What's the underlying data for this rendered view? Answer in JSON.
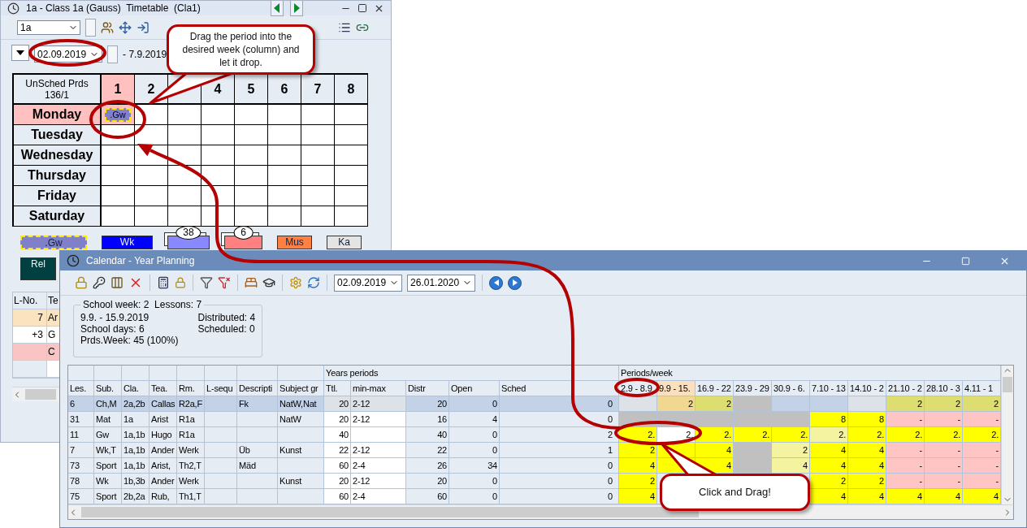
{
  "timetable_window": {
    "title": "1a - Class 1a (Gauss)  Timetable  (Cla1)",
    "class_select": "1a",
    "date": "02.09.2019",
    "date_range_end": "- 7.9.2019",
    "unscheduled": {
      "label": "UnSched Prds",
      "count": "136/1"
    },
    "periods": [
      {
        "label": "1",
        "selected": true
      },
      {
        "label": "2",
        "selected": false
      },
      {
        "selected": false
      },
      {
        "label": "4",
        "selected": false
      },
      {
        "label": "5",
        "selected": false
      },
      {
        "label": "6",
        "selected": false
      },
      {
        "label": "7",
        "selected": false
      },
      {
        "label": "8",
        "selected": false
      }
    ],
    "days": [
      {
        "label": "Monday",
        "selected": true,
        "slots": [
          {
            "selected": true,
            "lesson": ".Gw"
          },
          {
            "selected": false
          },
          {
            "selected": false
          },
          {
            "selected": false
          },
          {
            "selected": false
          },
          {
            "selected": false
          },
          {
            "selected": false
          },
          {
            "selected": false
          }
        ]
      },
      {
        "label": "Tuesday",
        "selected": false,
        "slots": [
          {
            "selected": false
          },
          {
            "selected": false
          },
          {
            "selected": false
          },
          {
            "selected": false
          },
          {
            "selected": false
          },
          {
            "selected": false
          },
          {
            "selected": false
          },
          {
            "selected": false
          }
        ]
      },
      {
        "label": "Wednesday",
        "selected": false,
        "slots": [
          {
            "selected": false
          },
          {
            "selected": false
          },
          {
            "selected": false
          },
          {
            "selected": false
          },
          {
            "selected": false
          },
          {
            "selected": false
          },
          {
            "selected": false
          },
          {
            "selected": false
          }
        ]
      },
      {
        "label": "Thursday",
        "selected": false,
        "slots": [
          {
            "selected": false
          },
          {
            "selected": false
          },
          {
            "selected": false
          },
          {
            "selected": false
          },
          {
            "selected": false
          },
          {
            "selected": false
          },
          {
            "selected": false
          },
          {
            "selected": false
          }
        ]
      },
      {
        "label": "Friday",
        "selected": false,
        "slots": [
          {
            "selected": false
          },
          {
            "selected": false
          },
          {
            "selected": false
          },
          {
            "selected": false
          },
          {
            "selected": false
          },
          {
            "selected": false
          },
          {
            "selected": false
          },
          {
            "selected": false
          }
        ]
      },
      {
        "label": "Saturday",
        "selected": false,
        "slots": [
          {
            "selected": false
          },
          {
            "selected": false
          },
          {
            "selected": false
          },
          {
            "selected": false
          },
          {
            "selected": false
          },
          {
            "selected": false
          },
          {
            "selected": false
          },
          {
            "selected": false
          }
        ]
      }
    ],
    "lesson_cards": [
      {
        "label": ".Gw",
        "color": "#8080c8",
        "selected": true
      },
      {
        "label": "Wk",
        "color": "#0000ff",
        "selected": false
      },
      {
        "badge": "38",
        "color": "#8888ff",
        "selected": false
      },
      {
        "badge": "6",
        "color": "#ff8080",
        "selected": false
      },
      {
        "label": "Mus",
        "color": "#ff8040",
        "selected": false
      },
      {
        "label": "Ka",
        "color": "#e4e4e4",
        "selected": false
      },
      {
        "label": "Rel",
        "color": "#004040",
        "selected": false
      }
    ],
    "lesson_list": {
      "columns": [
        "L-No.",
        "Te"
      ],
      "rows": [
        {
          "number": "7",
          "teacher": "Ar",
          "color": "#fbe3c0"
        },
        {
          "number": "+3",
          "teacher": "G",
          "color": "#ffffff"
        },
        {
          "teacher": "C",
          "color": "#f8c4c4"
        }
      ]
    }
  },
  "calendar_window": {
    "title": "Calendar - Year Planning",
    "date_from": "02.09.2019",
    "date_to": "26.01.2020",
    "info": {
      "legend": "School week: 2  Lessons: 7",
      "lines": [
        "9.9. - 15.9.2019",
        "School days: 6",
        "Prds.Week: 45 (100%)"
      ],
      "stats": [
        "Distributed: 4",
        "Scheduled: 0"
      ]
    },
    "table": {
      "years_group": "Years periods",
      "weeks_group": "Periods/week",
      "columns": [
        "Les.",
        "Sub.",
        "Cla.",
        "Tea.",
        "Rm.",
        "L-sequ",
        "Descripti",
        "Subject gr",
        "Ttl.",
        "min-max",
        "Distr",
        "Open",
        "Sched"
      ],
      "weeks": [
        {
          "label": "2.9 - 8.9",
          "selected": false
        },
        {
          "label": "9.9 - 15.",
          "selected": true
        },
        {
          "label": "16.9 - 22",
          "selected": false
        },
        {
          "label": "23.9 - 29",
          "selected": false
        },
        {
          "label": "30.9 - 6.",
          "selected": false
        },
        {
          "label": "7.10 - 13",
          "selected": false
        },
        {
          "label": "14.10 - 2",
          "selected": false
        },
        {
          "label": "21.10 - 2",
          "selected": false
        },
        {
          "label": "28.10 - 3",
          "selected": false
        },
        {
          "label": "4.11 - 1",
          "selected": false
        }
      ],
      "rows": [
        {
          "selected": true,
          "cells": [
            {
              "text": "6"
            },
            {
              "text": "Ch,M"
            },
            {
              "text": "2a,2b"
            },
            {
              "text": "Callas"
            },
            {
              "text": "R2a,F"
            },
            {},
            {
              "text": "Fk"
            },
            {
              "text": "NatW,Nat"
            },
            {
              "text": "20"
            },
            {
              "text": "2-12"
            },
            {
              "text": "20"
            },
            {
              "text": "0"
            },
            {
              "text": "0"
            }
          ],
          "weeks": [
            {
              "color": "#dde2e8"
            },
            {
              "value": "2",
              "color": "#f0d890"
            },
            {
              "value": "2",
              "color": "#dede70"
            },
            {
              "color": "#c0c0c0"
            },
            {
              "color": "#c4d2e8"
            },
            {
              "color": "#c4d2e8"
            },
            {
              "color": "#dde2e8"
            },
            {
              "value": "2",
              "color": "#dede70"
            },
            {
              "value": "2",
              "color": "#dede70"
            },
            {
              "value": "2",
              "color": "#dede70"
            }
          ]
        },
        {
          "selected": false,
          "cells": [
            {
              "text": "31"
            },
            {
              "text": "Mat"
            },
            {
              "text": "1a"
            },
            {
              "text": "Arist"
            },
            {
              "text": "R1a"
            },
            {},
            {},
            {
              "text": "NatW"
            },
            {
              "text": "20"
            },
            {
              "text": "2-12"
            },
            {
              "text": "16"
            },
            {
              "text": "4"
            },
            {
              "text": "0"
            }
          ],
          "weeks": [
            {
              "color": "#c0c0c0"
            },
            {
              "color": "#c0c0c0"
            },
            {
              "color": "#c0c0c0"
            },
            {
              "color": "#c0c0c0"
            },
            {
              "color": "#c0c0c0"
            },
            {
              "value": "8",
              "color": "#ffff00"
            },
            {
              "value": "8",
              "color": "#ffff00"
            },
            {
              "value": "-",
              "color": "#ffc4c4"
            },
            {
              "value": "-",
              "color": "#ffc4c4"
            },
            {
              "value": "-",
              "color": "#ffc4c4"
            }
          ]
        },
        {
          "selected": false,
          "cells": [
            {
              "text": "11"
            },
            {
              "text": "Gw"
            },
            {
              "text": "1a,1b"
            },
            {
              "text": "Hugo"
            },
            {
              "text": "R1a"
            },
            {},
            {},
            {},
            {
              "text": "40"
            },
            {},
            {
              "text": "40"
            },
            {
              "text": "0"
            },
            {
              "text": "2"
            }
          ],
          "weeks": [
            {
              "value": "2.",
              "color": "#ffff00"
            },
            {
              "value": "2.",
              "color": "#ffffff"
            },
            {
              "value": "2.",
              "color": "#ffff00"
            },
            {
              "value": "2.",
              "color": "#ffff00"
            },
            {
              "value": "2.",
              "color": "#ffff00"
            },
            {
              "value": "2.",
              "color": "#f4f4a0"
            },
            {
              "value": "2.",
              "color": "#ffff00"
            },
            {
              "value": "2.",
              "color": "#ffff00"
            },
            {
              "value": "2.",
              "color": "#ffff00"
            },
            {
              "value": "2.",
              "color": "#ffff00"
            }
          ]
        },
        {
          "selected": false,
          "cells": [
            {
              "text": "7"
            },
            {
              "text": "Wk,T"
            },
            {
              "text": "1a,1b"
            },
            {
              "text": "Ander"
            },
            {
              "text": "Werk"
            },
            {},
            {
              "text": "Üb"
            },
            {
              "text": "Kunst"
            },
            {
              "text": "22"
            },
            {
              "text": "2-12"
            },
            {
              "text": "22"
            },
            {
              "text": "0"
            },
            {
              "text": "1"
            }
          ],
          "weeks": [
            {
              "value": "2",
              "color": "#ffff00"
            },
            {
              "color": "#ffff00"
            },
            {
              "value": "4",
              "color": "#ffff00"
            },
            {
              "color": "#c0c0c0"
            },
            {
              "value": "2",
              "color": "#f4f4a0"
            },
            {
              "value": "4",
              "color": "#ffff00"
            },
            {
              "value": "4",
              "color": "#ffff00"
            },
            {
              "value": "-",
              "color": "#ffc4c4"
            },
            {
              "value": "-",
              "color": "#ffc4c4"
            },
            {
              "value": "-",
              "color": "#ffc4c4"
            }
          ]
        },
        {
          "selected": false,
          "cells": [
            {
              "text": "73"
            },
            {
              "text": "Sport"
            },
            {
              "text": "1a,1b"
            },
            {
              "text": "Arist,"
            },
            {
              "text": "Th2,T"
            },
            {},
            {
              "text": "Mäd"
            },
            {},
            {
              "text": "60"
            },
            {
              "text": "2-4"
            },
            {
              "text": "26"
            },
            {
              "text": "34"
            },
            {
              "text": "0"
            }
          ],
          "weeks": [
            {
              "value": "4",
              "color": "#ffff00"
            },
            {
              "color": "#ffff00"
            },
            {
              "value": "4",
              "color": "#ffff00"
            },
            {
              "color": "#c0c0c0"
            },
            {
              "value": "4",
              "color": "#f4f4a0"
            },
            {
              "value": "4",
              "color": "#ffff00"
            },
            {
              "value": "4",
              "color": "#ffff00"
            },
            {
              "value": "-",
              "color": "#ffc4c4"
            },
            {
              "value": "-",
              "color": "#ffc4c4"
            },
            {
              "value": "-",
              "color": "#ffc4c4"
            }
          ]
        },
        {
          "selected": false,
          "cells": [
            {
              "text": "78"
            },
            {
              "text": "Wk"
            },
            {
              "text": "1b,3b"
            },
            {
              "text": "Ander"
            },
            {
              "text": "Werk"
            },
            {},
            {},
            {
              "text": "Kunst"
            },
            {
              "text": "20"
            },
            {
              "text": "2-12"
            },
            {
              "text": "20"
            },
            {
              "text": "0"
            },
            {
              "text": "0"
            }
          ],
          "weeks": [
            {
              "value": "2",
              "color": "#ffff00"
            }
          ],
          "weeks_right": [
            {
              "value": "2",
              "color": "#ffff00"
            },
            {
              "value": "2",
              "color": "#ffff00"
            },
            {
              "value": "-",
              "color": "#ffc4c4"
            },
            {
              "value": "-",
              "color": "#ffc4c4"
            },
            {
              "value": "-",
              "color": "#ffc4c4"
            }
          ]
        },
        {
          "selected": false,
          "cells": [
            {
              "text": "75"
            },
            {
              "text": "Sport"
            },
            {
              "text": "2b,2a"
            },
            {
              "text": "Rub,"
            },
            {
              "text": "Th1,T"
            },
            {},
            {},
            {},
            {
              "text": "60"
            },
            {
              "text": "2-4"
            },
            {
              "text": "60"
            },
            {
              "text": "0"
            },
            {
              "text": "0"
            }
          ],
          "weeks": [
            {
              "value": "4",
              "color": "#ffff00"
            }
          ],
          "weeks_right": [
            {
              "value": "4",
              "color": "#ffff00"
            },
            {
              "value": "4",
              "color": "#ffff00"
            },
            {
              "value": "4",
              "color": "#ffff00"
            },
            {
              "value": "4",
              "color": "#ffff00"
            },
            {
              "value": "4",
              "color": "#ffff00"
            }
          ]
        }
      ]
    }
  },
  "callouts": [
    {
      "text": "Drag the period into the desired week (column) and let it drop."
    },
    {
      "text": "Click and Drag!"
    }
  ]
}
